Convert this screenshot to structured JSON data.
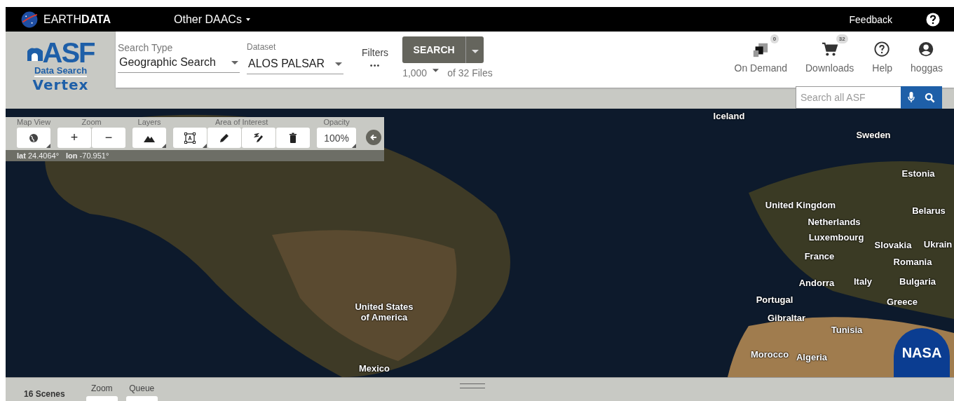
{
  "topbar": {
    "brand": "EARTH**DATA**",
    "menu": "Other DAACs",
    "feedback": "Feedback"
  },
  "logo": {
    "mark": "ASF",
    "subtitle": "Data Search",
    "name": "Vertex"
  },
  "search": {
    "search_type": {
      "label": "Search Type",
      "value": "Geographic Search"
    },
    "dataset": {
      "label": "Dataset",
      "value": "ALOS PALSAR"
    },
    "filters": {
      "label": "Filters",
      "dots": "•••"
    },
    "search_button": "SEARCH",
    "max_results": "1,000",
    "of_files": "of 32 Files"
  },
  "nav": [
    {
      "kind": "ondemand",
      "label": "On Demand",
      "badge": "0"
    },
    {
      "kind": "cart",
      "label": "Downloads",
      "badge": "32"
    },
    {
      "kind": "help",
      "label": "Help"
    },
    {
      "kind": "user",
      "label": "hoggas"
    }
  ],
  "site_search": {
    "placeholder": "Search all ASF"
  },
  "toolbar": {
    "groups": [
      {
        "label": "Map View",
        "buttons": [
          {
            "kind": "icon",
            "menu": true
          }
        ]
      },
      {
        "label": "Zoom",
        "buttons": [
          {
            "kind": "text",
            "text": "+"
          },
          {
            "kind": "text",
            "text": "−"
          }
        ]
      },
      {
        "label": "Layers",
        "buttons": [
          {
            "kind": "icon",
            "menu": true
          }
        ]
      },
      {
        "label": "Area of Interest",
        "buttons": [
          {
            "kind": "icon",
            "menu": true
          },
          {
            "kind": "icon",
            "menu": false
          },
          {
            "kind": "icon",
            "menu": false
          },
          {
            "kind": "icon",
            "menu": false
          }
        ]
      },
      {
        "label": "Opacity",
        "buttons": [
          {
            "kind": "text",
            "text": "100%",
            "menu": true
          }
        ]
      }
    ],
    "lat": "**lat** 24.4064°",
    "lon": "**lon** -70.951°"
  },
  "map_labels": [
    "Iceland",
    "Sweden",
    "Estonia",
    "United Kingdom",
    "Belarus",
    "Netherlands",
    "Luxembourg",
    "Slovakia",
    "Ukrain",
    "France",
    "Romania",
    "Andorra",
    "Italy",
    "Bulgaria",
    "Portugal",
    "Greece",
    "Gibraltar",
    "Tunisia",
    "Morocco",
    "Algeria",
    "United States\nof America",
    "Mexico"
  ],
  "map_logo": "NASA",
  "bottom": {
    "count": "16 Scenes",
    "zoom": "Zoom",
    "queue": "Queue"
  }
}
